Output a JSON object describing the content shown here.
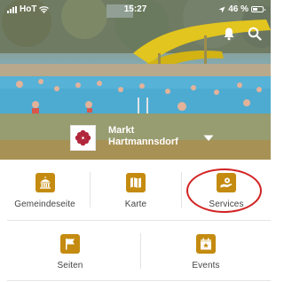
{
  "status_bar": {
    "carrier": "HoT",
    "time": "15:27",
    "battery_percent": "46 %",
    "icons": [
      "signal-icon",
      "wifi-icon",
      "location-arrow-icon",
      "battery-icon"
    ]
  },
  "header": {
    "icons": [
      "bell-icon",
      "search-icon"
    ],
    "town": {
      "name_line1": "Markt",
      "name_line2": "Hartmannsdorf",
      "logo_icon": "municipal-crest-icon",
      "dropdown_icon": "chevron-down-icon"
    }
  },
  "menu": {
    "row1": [
      {
        "label": "Gemeindeseite",
        "icon": "town-hall-icon"
      },
      {
        "label": "Karte",
        "icon": "map-icon"
      },
      {
        "label": "Services",
        "icon": "service-hand-icon",
        "highlighted": true
      }
    ],
    "row2": [
      {
        "label": "Seiten",
        "icon": "flag-icon"
      },
      {
        "label": "Events",
        "icon": "calendar-star-icon"
      }
    ]
  },
  "colors": {
    "accent": "#c48b10",
    "town_bar": "#b09448",
    "highlight": "#d22222",
    "crest": "#b1263b"
  }
}
